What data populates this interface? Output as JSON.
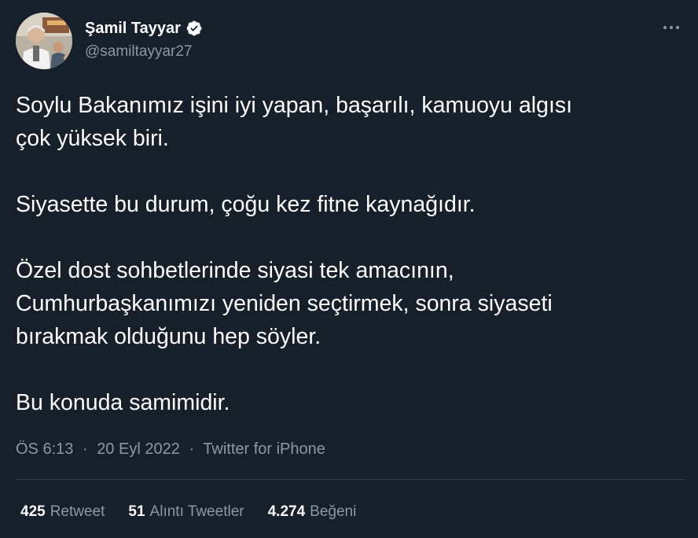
{
  "author": {
    "display_name": "Şamil Tayyar",
    "handle": "@samiltayyar27",
    "verified": true
  },
  "tweet": {
    "paragraphs": [
      "Soylu Bakanımız işini iyi yapan, başarılı, kamuoyu algısı\nçok yüksek biri.",
      "Siyasette bu durum, çoğu kez fitne kaynağıdır.",
      "Özel dost sohbetlerinde siyasi tek amacının,\nCumhurbaşkanımızı yeniden seçtirmek, sonra siyaseti\nbırakmak olduğunu hep söyler.",
      "Bu konuda samimidir."
    ]
  },
  "meta": {
    "time": "ÖS 6:13",
    "date": "20 Eyl 2022",
    "source": "Twitter for iPhone",
    "separator": "·"
  },
  "stats": {
    "retweets_count": "425",
    "retweets_label": "Retweet",
    "quotes_count": "51",
    "quotes_label": "Alıntı Tweetler",
    "likes_count": "4.274",
    "likes_label": "Beğeni"
  },
  "icons": {
    "verified": "verified-badge-icon",
    "more": "more-horizontal-icon"
  },
  "colors": {
    "background": "#15202b",
    "text_primary": "#ffffff",
    "text_secondary": "#8b98a5",
    "divider": "#38444d"
  }
}
